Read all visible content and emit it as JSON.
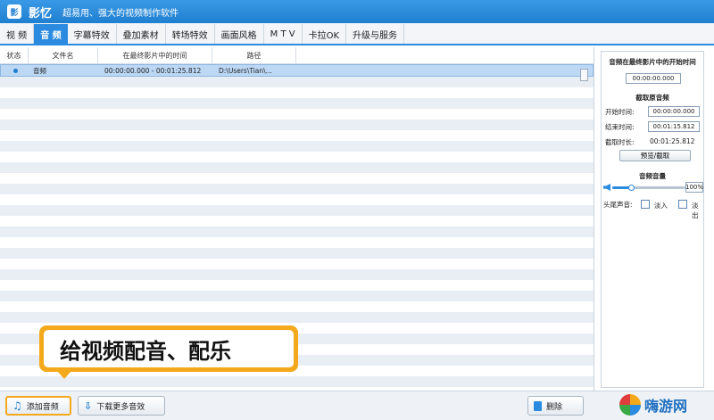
{
  "app": {
    "logo": "影",
    "name": "影忆",
    "slogan": "超易用、强大的视频制作软件"
  },
  "tabs": [
    "视 频",
    "音 频",
    "字幕特效",
    "叠加素材",
    "转场特效",
    "画面风格",
    "M T V",
    "卡拉OK",
    "升级与服务"
  ],
  "active_tab_index": 1,
  "table": {
    "headers": [
      "状态",
      "文件名",
      "在最终影片中的时间",
      "路径"
    ],
    "rows": [
      {
        "status": "dot",
        "name": "音频",
        "time": "00:00:00.000 - 00:01:25.812",
        "path": "D:\\Users\\Tian\\..."
      }
    ]
  },
  "callout": "给视频配音、配乐",
  "bottom": {
    "add_audio": "添加音频",
    "download_more": "下载更多音效",
    "delete": "删除"
  },
  "panel": {
    "start_title": "音频在最终影片中的开始时间",
    "start_value": "00:00:00.000",
    "trim_title": "截取原音频",
    "start_label": "开始时间:",
    "start_time": "00:00:00.000",
    "end_label": "结束时间:",
    "end_time": "00:01:15.812",
    "dur_label": "截取时长:",
    "dur_value": "00:01:25.812",
    "trim_button": "预览/截取",
    "volume_title": "音频音量",
    "volume_value": "100%",
    "volume_level": 0.25,
    "fade_label": "头尾声音:",
    "fade_in": "淡入",
    "fade_out": "淡出"
  },
  "watermark": "嗨游网"
}
